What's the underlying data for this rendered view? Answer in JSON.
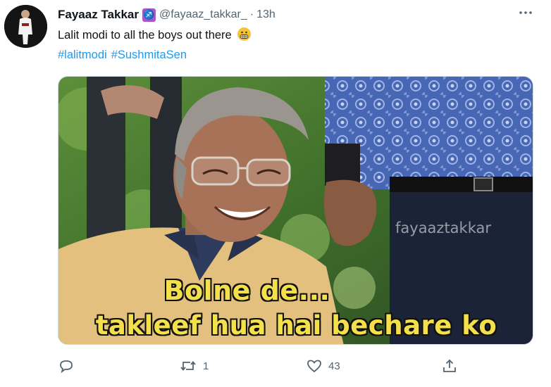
{
  "tweet": {
    "author_name": "Fayaaz Takkar",
    "badge_icon": "sagittarius-icon",
    "handle": "@fayaaz_takkar_",
    "separator": "·",
    "time": "13h",
    "text": "Lalit modi to all the boys out there",
    "emoji_icon": "grimacing-face-icon",
    "hashtags": [
      "#lalitmodi",
      "#SushmitaSen"
    ]
  },
  "media": {
    "caption_line1": "Bolne de...",
    "caption_line2": "takleef hua hai bechare ko",
    "watermark": "fayaaztakkar"
  },
  "actions": {
    "reply_count": "",
    "retweet_count": "1",
    "like_count": "43"
  },
  "colors": {
    "link": "#1d9bf0",
    "secondary_text": "#536471",
    "caption_yellow": "#f4e04a"
  }
}
